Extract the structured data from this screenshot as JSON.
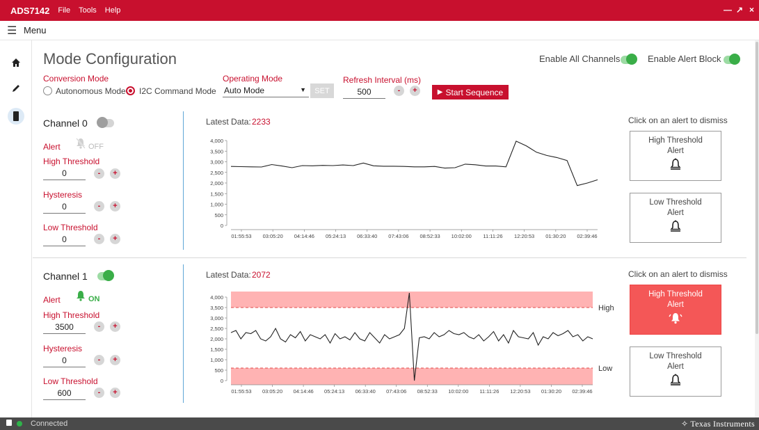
{
  "titlebar": {
    "app_name": "ADS7142",
    "menus": [
      "File",
      "Tools",
      "Help"
    ]
  },
  "menubar": {
    "label": "Menu"
  },
  "page": {
    "title": "Mode Configuration"
  },
  "global_toggles": {
    "enable_all_channels": "Enable All Channels",
    "enable_alert_block": "Enable Alert Block"
  },
  "config": {
    "conversion_mode_label": "Conversion Mode",
    "conversion_modes": [
      "Autonomous Mode",
      "I2C Command Mode"
    ],
    "conversion_mode_selected": "I2C Command Mode",
    "operating_mode_label": "Operating Mode",
    "operating_mode_value": "Auto Mode",
    "set_label": "SET",
    "refresh_label": "Refresh Interval (ms)",
    "refresh_value": "500",
    "start_label": "Start Sequence"
  },
  "channels": [
    {
      "name": "Channel 0",
      "enabled": false,
      "alert_label": "Alert",
      "alert_state": "OFF",
      "high_threshold_label": "High Threshold",
      "high_threshold": "0",
      "hysteresis_label": "Hysteresis",
      "hysteresis": "0",
      "low_threshold_label": "Low Threshold",
      "low_threshold": "0",
      "latest_label": "Latest Data:",
      "latest_value": "2233",
      "dismiss_hint": "Click on an alert to dismiss",
      "high_alert": [
        "High Threshold",
        "Alert"
      ],
      "high_alert_active": false,
      "low_alert": [
        "Low Threshold",
        "Alert"
      ],
      "low_alert_active": false
    },
    {
      "name": "Channel 1",
      "enabled": true,
      "alert_label": "Alert",
      "alert_state": "ON",
      "high_threshold_label": "High Threshold",
      "high_threshold": "3500",
      "hysteresis_label": "Hysteresis",
      "hysteresis": "0",
      "low_threshold_label": "Low Threshold",
      "low_threshold": "600",
      "latest_label": "Latest Data:",
      "latest_value": "2072",
      "dismiss_hint": "Click on an alert to dismiss",
      "high_alert": [
        "High Threshold",
        "Alert"
      ],
      "high_alert_active": true,
      "low_alert": [
        "Low Threshold",
        "Alert"
      ],
      "low_alert_active": false
    }
  ],
  "chart_data": [
    {
      "type": "line",
      "ylim": [
        0,
        4000
      ],
      "y_ticks": [
        "0",
        "500",
        "1,000",
        "1,500",
        "2,000",
        "2,500",
        "3,000",
        "3,500",
        "4,000"
      ],
      "x_ticks": [
        "01:55:53",
        "03:05:20",
        "04:14:46",
        "05:24:13",
        "06:33:40",
        "07:43:06",
        "08:52:33",
        "10:02:00",
        "11:11:26",
        "12:20:53",
        "01:30:20",
        "02:39:46"
      ],
      "series": [
        {
          "values": [
            2780,
            2770,
            2760,
            2755,
            2870,
            2800,
            2720,
            2820,
            2810,
            2830,
            2820,
            2850,
            2820,
            2940,
            2810,
            2790,
            2790,
            2780,
            2760,
            2760,
            2780,
            2700,
            2720,
            2890,
            2860,
            2800,
            2800,
            2760,
            3970,
            3750,
            3450,
            3300,
            3200,
            3060,
            1880,
            2000,
            2150
          ]
        }
      ]
    },
    {
      "type": "line",
      "ylim": [
        0,
        4000
      ],
      "y_ticks": [
        "0",
        "500",
        "1,000",
        "1,500",
        "2,000",
        "2,500",
        "3,000",
        "3,500",
        "4,000"
      ],
      "x_ticks": [
        "01:55:53",
        "03:05:20",
        "04:14:46",
        "05:24:13",
        "06:33:40",
        "07:43:06",
        "08:52:33",
        "10:02:00",
        "11:11:26",
        "12:20:53",
        "01:30:20",
        "02:39:46"
      ],
      "threshold_labels": {
        "high": "High",
        "low": "Low"
      },
      "high_threshold": 3500,
      "low_threshold": 600,
      "series": [
        {
          "values": [
            2300,
            2400,
            2000,
            2300,
            2250,
            2400,
            2000,
            1900,
            2100,
            2500,
            2000,
            1850,
            2200,
            2050,
            2350,
            1900,
            2200,
            2100,
            2000,
            2200,
            1800,
            2250,
            2000,
            2100,
            1950,
            2300,
            2000,
            1900,
            2300,
            2050,
            1800,
            2200,
            2000,
            2100,
            2200,
            2500,
            4200,
            0,
            2050,
            2100,
            2000,
            2300,
            2100,
            2200,
            2400,
            2250,
            2200,
            2300,
            2100,
            2000,
            2200,
            1900,
            2100,
            2350,
            1900,
            2200,
            1800,
            2400,
            2100,
            2050,
            2000,
            2300,
            1700,
            2100,
            2000,
            2300,
            2150,
            2250,
            2400,
            2100,
            2200,
            1900,
            2100,
            2000
          ]
        }
      ]
    }
  ],
  "statusbar": {
    "status": "Connected",
    "brand": "Texas Instruments"
  }
}
